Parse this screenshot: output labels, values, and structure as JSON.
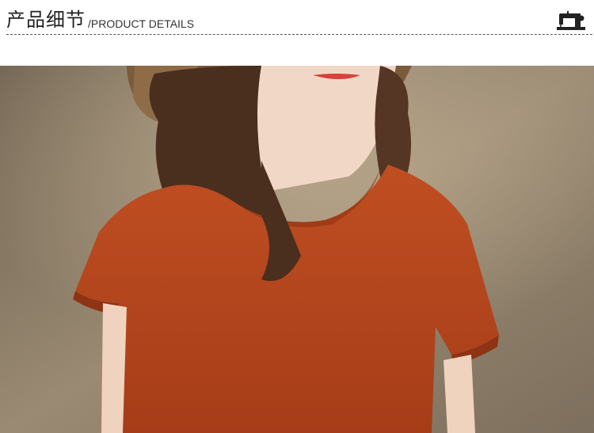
{
  "header": {
    "title_cn": "产品细节",
    "title_en": "/PRODUCT DETAILS",
    "icon": "sewing-machine-icon"
  },
  "photo": {
    "subject": "product-photo",
    "colors": {
      "background": "#8a7b68",
      "shirt": "#b8461f",
      "hair": "#4a2e1e",
      "skin": "#f1d8c6",
      "hat": "#7a5b3c"
    }
  }
}
